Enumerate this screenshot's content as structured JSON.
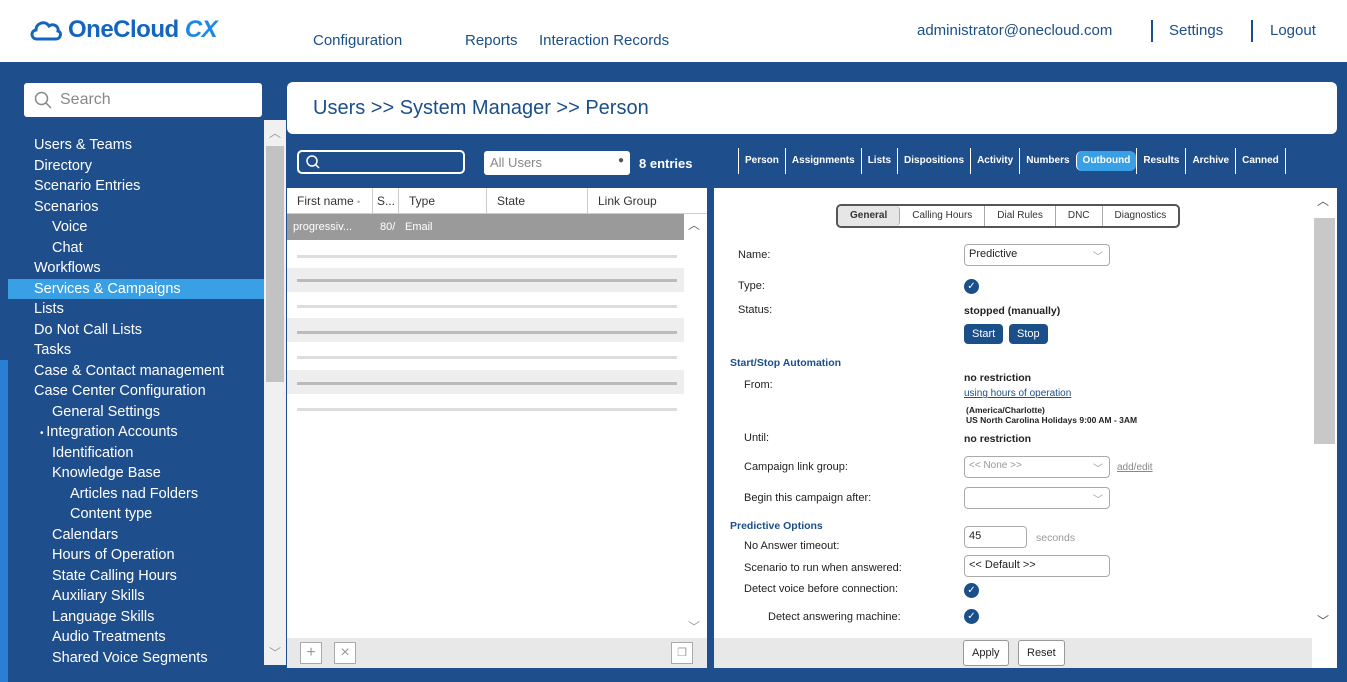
{
  "app": {
    "logo_one": "OneCloud",
    "logo_cx": "CX"
  },
  "topnav": {
    "configuration": "Configuration",
    "reports": "Reports",
    "interaction_records": "Interaction Records",
    "user_email": "administrator@onecloud.com",
    "settings": "Settings",
    "logout": "Logout"
  },
  "search": {
    "placeholder": "Search"
  },
  "sidebar": {
    "items": [
      {
        "label": "Users & Teams",
        "indent": 0
      },
      {
        "label": "Directory",
        "indent": 0
      },
      {
        "label": "Scenario Entries",
        "indent": 0
      },
      {
        "label": "Scenarios",
        "indent": 0
      },
      {
        "label": "Voice",
        "indent": 1
      },
      {
        "label": "Chat",
        "indent": 1
      },
      {
        "label": "Workflows",
        "indent": 0
      },
      {
        "label": "Services & Campaigns",
        "indent": 0,
        "active": true
      },
      {
        "label": "Lists",
        "indent": 0
      },
      {
        "label": "Do Not Call Lists",
        "indent": 0
      },
      {
        "label": "Tasks",
        "indent": 0
      },
      {
        "label": "Case & Contact management",
        "indent": 0
      },
      {
        "label": "Case Center Configuration",
        "indent": 0
      },
      {
        "label": "General Settings",
        "indent": 1
      },
      {
        "label": "Integration Accounts",
        "indent": 1,
        "bullet": true
      },
      {
        "label": "Identification",
        "indent": 1
      },
      {
        "label": "Knowledge Base",
        "indent": 1
      },
      {
        "label": "Articles nad Folders",
        "indent": 2
      },
      {
        "label": "Content type",
        "indent": 2
      },
      {
        "label": "Calendars",
        "indent": 1
      },
      {
        "label": "Hours of Operation",
        "indent": 1
      },
      {
        "label": "State Calling Hours",
        "indent": 1
      },
      {
        "label": "Auxiliary Skills",
        "indent": 1
      },
      {
        "label": "Language Skills",
        "indent": 1
      },
      {
        "label": "Audio Treatments",
        "indent": 1
      },
      {
        "label": "Shared Voice Segments",
        "indent": 1
      }
    ]
  },
  "header": {
    "breadcrumb": "Users >> System Manager >> Person"
  },
  "list": {
    "filter_value": "All Users",
    "entries": "8 entries",
    "columns": [
      "First name",
      "S...",
      "Type",
      "State",
      "Link Group"
    ],
    "selected_row": {
      "first_name": "progressiv...",
      "s": "80/",
      "type": "Email"
    }
  },
  "tabs": [
    "Person",
    "Assignments",
    "Lists",
    "Dispositions",
    "Activity",
    "Numbers",
    "Outbound",
    "Results",
    "Archive",
    "Canned"
  ],
  "active_tab": "Outbound",
  "subtabs": [
    "General",
    "Calling Hours",
    "Dial Rules",
    "DNC",
    "Diagnostics"
  ],
  "form": {
    "name_label": "Name:",
    "name_value": "Predictive",
    "type_label": "Type:",
    "status_label": "Status:",
    "status_value": "stopped (manually)",
    "start_btn": "Start",
    "stop_btn": "Stop",
    "automation_section": "Start/Stop Automation",
    "from_label": "From:",
    "from_value": "no restriction",
    "hours_link": "using hours of operation",
    "tz": "(America/Charlotte)",
    "holidays": "US North Carolina Holidays 9:00 AM - 3AM",
    "until_label": "Until:",
    "until_value": "no restriction",
    "link_group_label": "Campaign link group:",
    "link_group_value": "<< None >>",
    "add_edit": "add/edit",
    "begin_after_label": "Begin this campaign after:",
    "begin_after_value": "",
    "predictive_section": "Predictive Options",
    "no_answer_label": "No Answer timeout:",
    "no_answer_value": "45",
    "seconds": "seconds",
    "scenario_label": "Scenario to run when answered:",
    "scenario_value": "<< Default >>",
    "detect_voice_label": "Detect voice before connection:",
    "detect_machine_label": "Detect answering machine:",
    "apply_btn": "Apply",
    "reset_btn": "Reset"
  }
}
